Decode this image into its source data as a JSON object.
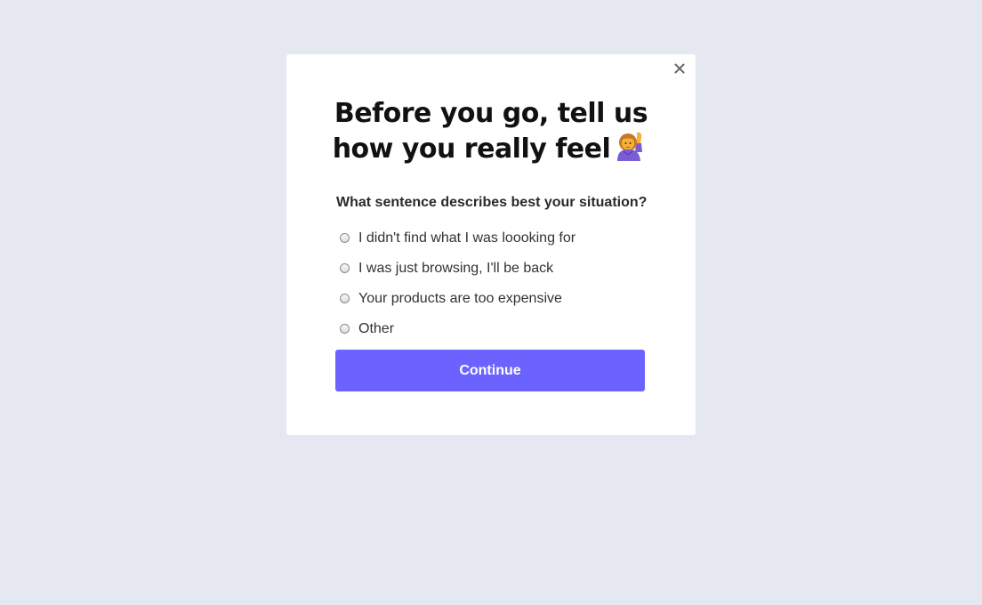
{
  "modal": {
    "close_icon": "close-icon",
    "title_line1": "Before you go, tell us",
    "title_line2": "how you really feel",
    "title_emoji_icon": "person-raising-hand-icon",
    "question": "What sentence describes best your situation?",
    "options": [
      {
        "label": "I didn't find what I was loooking for",
        "selected": false
      },
      {
        "label": "I was just browsing, I'll be back",
        "selected": false
      },
      {
        "label": "Your products are too expensive",
        "selected": false
      },
      {
        "label": "Other",
        "selected": false
      }
    ],
    "continue_label": "Continue"
  },
  "colors": {
    "background": "#e5e8f0",
    "modal": "#ffffff",
    "accent": "#6c63ff"
  }
}
